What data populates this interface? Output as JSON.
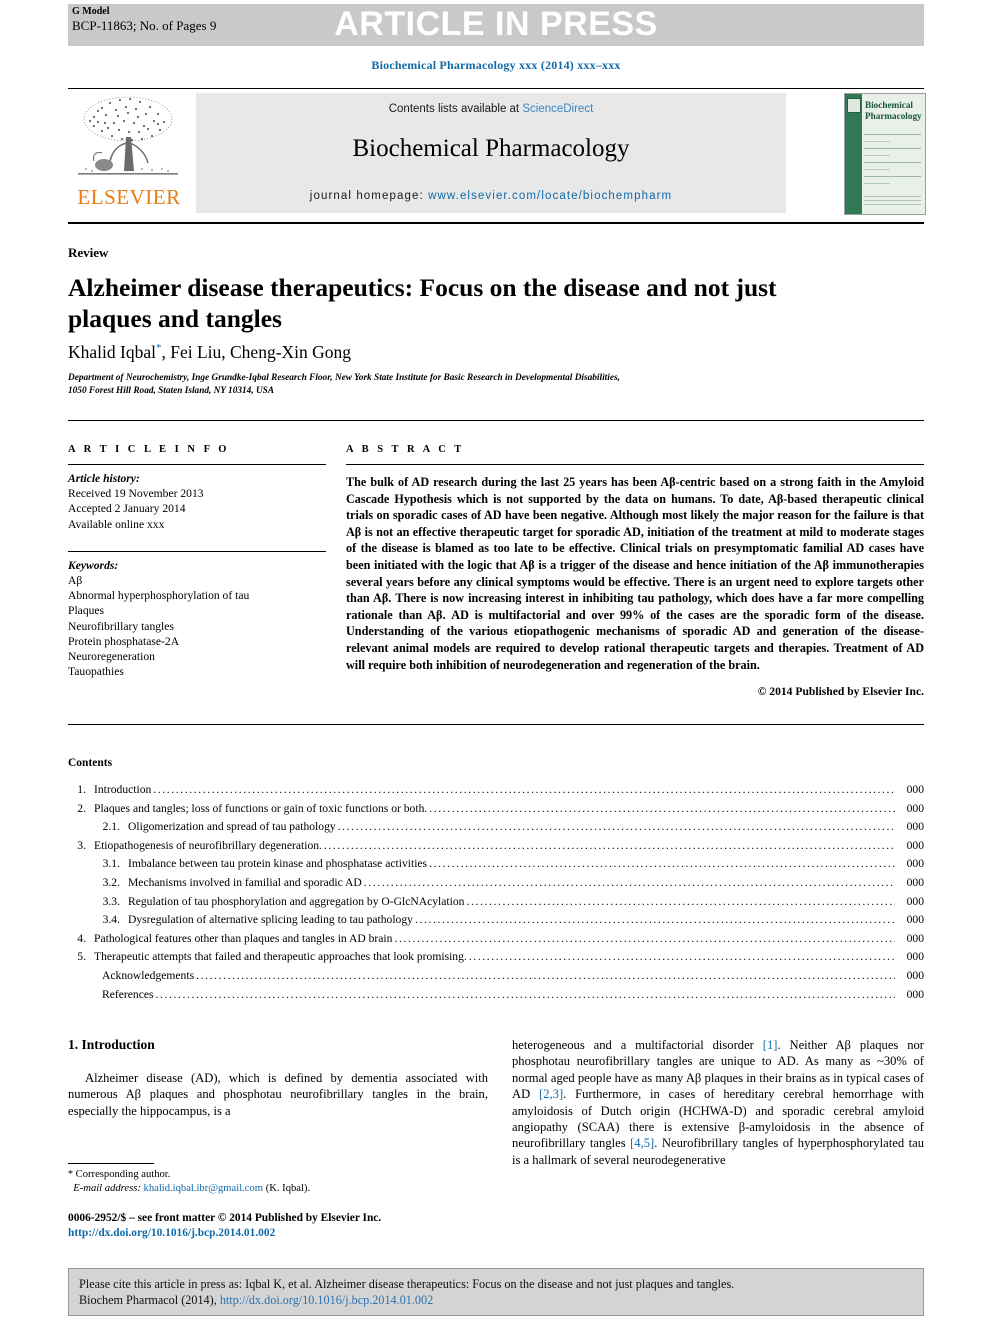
{
  "header": {
    "g_model_label": "G Model",
    "manuscript_id": "BCP-11863; No. of Pages 9",
    "banner": "ARTICLE IN PRESS",
    "journal_citation": "Biochemical Pharmacology xxx (2014) xxx–xxx"
  },
  "masthead": {
    "contents_prefix": "Contents lists available at ",
    "sciencedirect": "ScienceDirect",
    "journal_title": "Biochemical Pharmacology",
    "homepage_prefix": "journal homepage: ",
    "homepage_url": "www.elsevier.com/locate/biochempharm",
    "publisher": "ELSEVIER",
    "cover_title": "Biochemical Pharmacology"
  },
  "article": {
    "type_label": "Review",
    "title": "Alzheimer disease therapeutics: Focus on the disease and not just plaques and tangles",
    "authors": "Khalid Iqbal",
    "authors_rest": ", Fei Liu, Cheng-Xin Gong",
    "corresponding_marker": "*",
    "affiliation_line1": "Department of Neurochemistry, Inge Grundke-Iqbal Research Floor, New York State Institute for Basic Research in Developmental Disabilities,",
    "affiliation_line2": "1050 Forest Hill Road, Staten Island, NY 10314, USA"
  },
  "article_info": {
    "heading": "A R T I C L E  I N F O",
    "history_label": "Article history:",
    "received": "Received 19 November 2013",
    "accepted": "Accepted 2 January 2014",
    "available": "Available online xxx",
    "keywords_label": "Keywords:",
    "keywords": [
      "Aβ",
      "Abnormal hyperphosphorylation of tau",
      "Plaques",
      "Neurofibrillary tangles",
      "Protein phosphatase-2A",
      "Neuroregeneration",
      "Tauopathies"
    ]
  },
  "abstract": {
    "heading": "A B S T R A C T",
    "body": "The bulk of AD research during the last 25 years has been Aβ-centric based on a strong faith in the Amyloid Cascade Hypothesis which is not supported by the data on humans. To date, Aβ-based therapeutic clinical trials on sporadic cases of AD have been negative. Although most likely the major reason for the failure is that Aβ is not an effective therapeutic target for sporadic AD, initiation of the treatment at mild to moderate stages of the disease is blamed as too late to be effective. Clinical trials on presymptomatic familial AD cases have been initiated with the logic that Aβ is a trigger of the disease and hence initiation of the Aβ immunotherapies several years before any clinical symptoms would be effective. There is an urgent need to explore targets other than Aβ. There is now increasing interest in inhibiting tau pathology, which does have a far more compelling rationale than Aβ. AD is multifactorial and over 99% of the cases are the sporadic form of the disease. Understanding of the various etiopathogenic mechanisms of sporadic AD and generation of the disease-relevant animal models are required to develop rational therapeutic targets and therapies. Treatment of AD will require both inhibition of neurodegeneration and regeneration of the brain.",
    "copyright": "© 2014 Published by Elsevier Inc."
  },
  "contents": {
    "heading": "Contents",
    "items": [
      {
        "num": "1.",
        "level": 0,
        "text": "Introduction",
        "page": "000"
      },
      {
        "num": "2.",
        "level": 0,
        "text": "Plaques and tangles; loss of functions or gain of toxic functions or both.",
        "page": "000"
      },
      {
        "num": "2.1.",
        "level": 1,
        "text": "Oligomerization and spread of tau pathology",
        "page": "000"
      },
      {
        "num": "3.",
        "level": 0,
        "text": "Etiopathogenesis of neurofibrillary degeneration.",
        "page": "000"
      },
      {
        "num": "3.1.",
        "level": 1,
        "text": "Imbalance between tau protein kinase and phosphatase activities",
        "page": "000"
      },
      {
        "num": "3.2.",
        "level": 1,
        "text": "Mechanisms involved in familial and sporadic AD",
        "page": "000"
      },
      {
        "num": "3.3.",
        "level": 1,
        "text": "Regulation of tau phosphorylation and aggregation by O-GlcNAcylation",
        "page": "000"
      },
      {
        "num": "3.4.",
        "level": 1,
        "text": "Dysregulation of alternative splicing leading to tau pathology",
        "page": "000"
      },
      {
        "num": "4.",
        "level": 0,
        "text": "Pathological features other than plaques and tangles in AD brain",
        "page": "000"
      },
      {
        "num": "5.",
        "level": 0,
        "text": "Therapeutic attempts that failed and therapeutic approaches that look promising.",
        "page": "000"
      },
      {
        "num": "",
        "level": 2,
        "text": "Acknowledgements",
        "page": "000"
      },
      {
        "num": "",
        "level": 2,
        "text": "References",
        "page": "000"
      }
    ]
  },
  "introduction": {
    "heading": "1. Introduction",
    "left_paragraph": "Alzheimer disease (AD), which is defined by dementia associated with numerous Aβ plaques and phosphotau neurofibrillary tangles in the brain, especially the hippocampus, is a",
    "right_paragraph_1": "heterogeneous and a multifactorial disorder ",
    "right_ref_1": "[1]",
    "right_paragraph_2": ". Neither Aβ plaques nor phosphotau neurofibrillary tangles are unique to AD. As many as ~30% of normal aged people have as many Aβ plaques in their brains as in typical cases of AD ",
    "right_ref_2": "[2,3]",
    "right_paragraph_3": ". Furthermore, in cases of hereditary cerebral hemorrhage with amyloidosis of Dutch origin (HCHWA-D) and sporadic cerebral amyloid angiopathy (SCAA) there is extensive β-amyloidosis in the absence of neurofibrillary tangles ",
    "right_ref_3": "[4,5]",
    "right_paragraph_4": ". Neurofibrillary tangles of hyperphosphorylated tau is a hallmark of several neurodegenerative"
  },
  "footnote": {
    "star": "*",
    "corresponding": "Corresponding author.",
    "email_label": "E-mail address:",
    "email": "khalid.iqbal.ibr@gmail.com",
    "email_suffix": "(K. Iqbal).",
    "issn_line": "0006-2952/$ – see front matter © 2014 Published by Elsevier Inc.",
    "doi": "http://dx.doi.org/10.1016/j.bcp.2014.01.002"
  },
  "cite_box": {
    "line1": "Please cite this article in press as: Iqbal K, et al. Alzheimer disease therapeutics: Focus on the disease and not just plaques and tangles.",
    "line2_prefix": "Biochem Pharmacol (2014), ",
    "line2_doi": "http://dx.doi.org/10.1016/j.bcp.2014.01.002"
  },
  "colors": {
    "link_blue": "#0f6aa8",
    "sciencedirect_blue": "#3b86c4",
    "elsevier_orange": "#e87b12",
    "banner_grey": "#c9c9c9",
    "masthead_grey": "#e8e8e8",
    "cite_grey": "#d4d4d4",
    "cover_green": "#2f7a52"
  }
}
